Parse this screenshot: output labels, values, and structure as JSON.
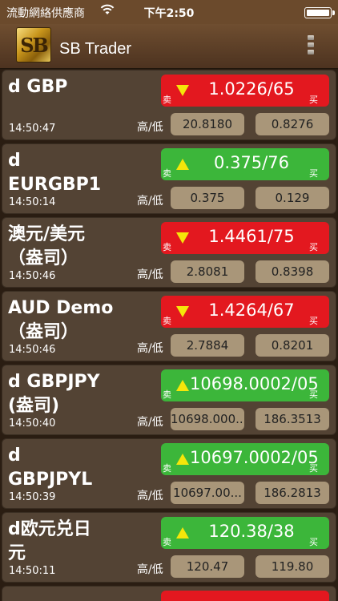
{
  "status_bar": {
    "carrier": "流動網絡供應商",
    "time": "下午2:50"
  },
  "header": {
    "logo_text": "SB",
    "title": "SB Trader"
  },
  "colors": {
    "down": "#e3181f",
    "up": "#3cb63a",
    "arrow_down": "#f5e60a",
    "arrow_up": "#f5e60a"
  },
  "labels": {
    "high_low": "高/低",
    "sell": "卖",
    "buy": "买"
  },
  "quotes": [
    {
      "symbol_lines": [
        "d GBP"
      ],
      "price": "1.0226/65",
      "direction": "down",
      "time": "14:50:47",
      "high": "20.8180",
      "low": "0.8276"
    },
    {
      "symbol_lines": [
        "d",
        "EURGBP1"
      ],
      "price": "0.375/76",
      "direction": "up",
      "time": "14:50:14",
      "high": "0.375",
      "low": "0.129"
    },
    {
      "symbol_lines": [
        "澳元/美元",
        "（盎司）"
      ],
      "price": "1.4461/75",
      "direction": "down",
      "time": "14:50:46",
      "high": "2.8081",
      "low": "0.8398"
    },
    {
      "symbol_lines": [
        "AUD Demo",
        "（盎司）"
      ],
      "price": "1.4264/67",
      "direction": "down",
      "time": "14:50:46",
      "high": "2.7884",
      "low": "0.8201"
    },
    {
      "symbol_lines": [
        "d GBPJPY",
        "(盎司)"
      ],
      "price": "10698.0002/05",
      "direction": "up",
      "time": "14:50:40",
      "high": "10698.000...",
      "low": "186.3513"
    },
    {
      "symbol_lines": [
        "d",
        "GBPJPYL"
      ],
      "price": "10697.0002/05",
      "direction": "up",
      "time": "14:50:39",
      "high": "10697.00...",
      "low": "186.2813"
    },
    {
      "symbol_lines": [
        "d欧元兑日",
        "元"
      ],
      "price": "120.38/38",
      "direction": "up",
      "time": "14:50:11",
      "high": "120.47",
      "low": "119.80"
    }
  ]
}
